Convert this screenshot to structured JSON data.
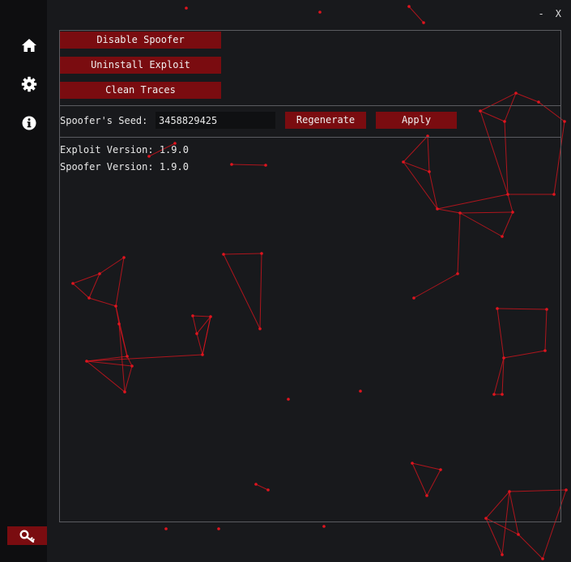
{
  "window": {
    "minimize_label": "-",
    "close_label": "X"
  },
  "sidebar": {
    "items": [
      {
        "icon": "home-icon"
      },
      {
        "icon": "gear-icon"
      },
      {
        "icon": "info-icon"
      }
    ],
    "bottom_button_icon": "key-icon"
  },
  "actions": {
    "disable_spoofer": "Disable Spoofer",
    "uninstall_exploit": "Uninstall Exploit",
    "clean_traces": "Clean Traces"
  },
  "seed": {
    "label": "Spoofer's Seed:",
    "value": "3458829425",
    "regenerate_label": "Regenerate",
    "apply_label": "Apply"
  },
  "versions": {
    "exploit": "Exploit Version: 1.9.0",
    "spoofer": "Spoofer Version: 1.9.0"
  },
  "colors": {
    "accent": "#7a0c10",
    "background": "#18191c",
    "sidebar": "#0e0e10",
    "particle": "#e0141e"
  }
}
